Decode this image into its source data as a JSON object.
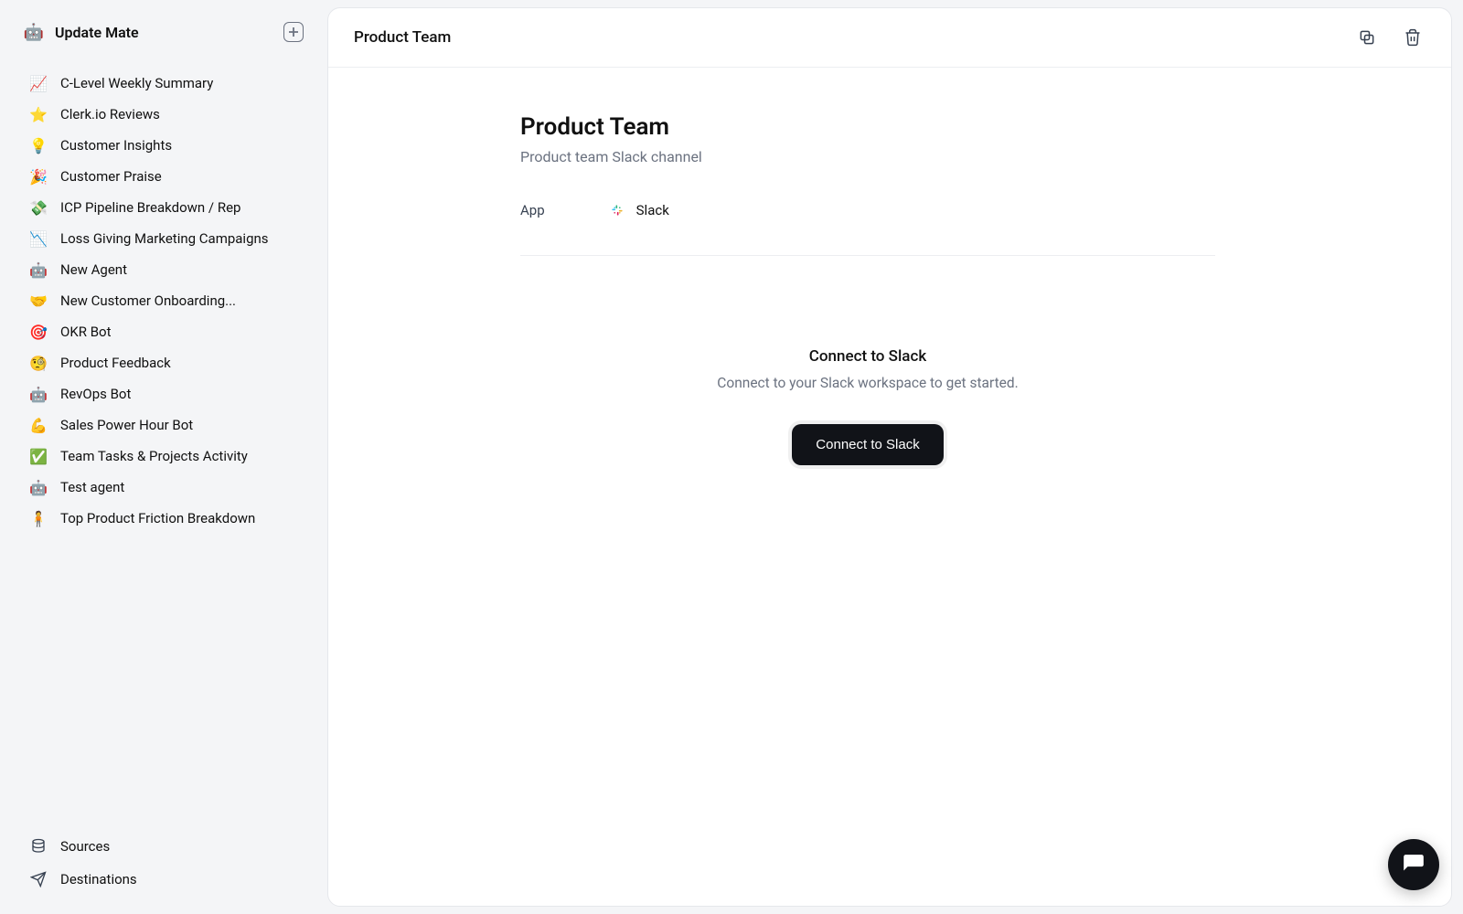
{
  "sidebar": {
    "brand": "Update Mate",
    "items": [
      {
        "icon": "📈",
        "label": "C-Level Weekly Summary"
      },
      {
        "icon": "⭐",
        "label": "Clerk.io Reviews"
      },
      {
        "icon": "💡",
        "label": "Customer Insights"
      },
      {
        "icon": "🎉",
        "label": "Customer Praise"
      },
      {
        "icon": "💸",
        "label": "ICP Pipeline Breakdown / Rep"
      },
      {
        "icon": "📉",
        "label": "Loss Giving Marketing Campaigns"
      },
      {
        "icon": "🤖",
        "label": "New Agent"
      },
      {
        "icon": "🤝",
        "label": "New Customer Onboarding..."
      },
      {
        "icon": "🎯",
        "label": "OKR Bot"
      },
      {
        "icon": "🧐",
        "label": "Product Feedback"
      },
      {
        "icon": "🤖",
        "label": "RevOps Bot"
      },
      {
        "icon": "💪",
        "label": "Sales Power Hour Bot"
      },
      {
        "icon": "✅",
        "label": "Team Tasks & Projects Activity"
      },
      {
        "icon": "🤖",
        "label": "Test agent"
      },
      {
        "icon": "🧍",
        "label": "Top Product Friction Breakdown"
      }
    ],
    "footer": {
      "sources": "Sources",
      "destinations": "Destinations"
    }
  },
  "header": {
    "title": "Product Team"
  },
  "detail": {
    "title": "Product Team",
    "subtitle": "Product team Slack channel",
    "meta_label": "App",
    "meta_value": "Slack"
  },
  "connect": {
    "title": "Connect to Slack",
    "subtitle": "Connect to your Slack workspace to get started.",
    "button": "Connect to Slack"
  }
}
